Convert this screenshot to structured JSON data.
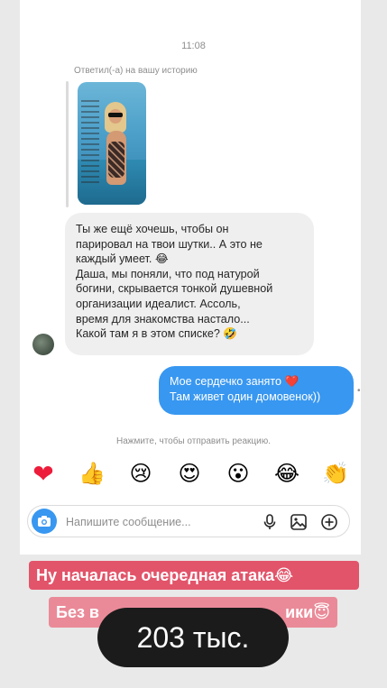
{
  "chat": {
    "time": "11:08",
    "reply_caption": "Ответил(-а) на вашу историю",
    "incoming_lines": [
      "Ты же ещё хочешь, чтобы он",
      "парировал на твои шутки.. А это не",
      "каждый умеет. 😂",
      "Даша, мы поняли, что под натурой",
      "богини, скрывается тонкой душевной",
      "организации идеалист. Ассоль,",
      "время для знакомства настало...",
      "Какой там я в этом списке? 🤣"
    ],
    "outgoing_lines": [
      "Мое сердечко занято ❤️",
      "Там живет один домовенок))"
    ],
    "more_glyph": "•"
  },
  "reactions": {
    "hint": "Нажмите, чтобы отправить реакцию.",
    "items": [
      "❤",
      "👍",
      "😢",
      "😍",
      "😮",
      "😂",
      "👏"
    ]
  },
  "composer": {
    "placeholder": "Напишите сообщение..."
  },
  "overlay": {
    "caption_1": "Ну началась очередная атака😂",
    "caption_2_left": "Без в",
    "caption_2_right": "ики😇",
    "views": "203 тыс."
  },
  "colors": {
    "accent": "#3897f0",
    "caption_1_bg": "#e2546a",
    "caption_2_bg": "#ea8a98"
  }
}
